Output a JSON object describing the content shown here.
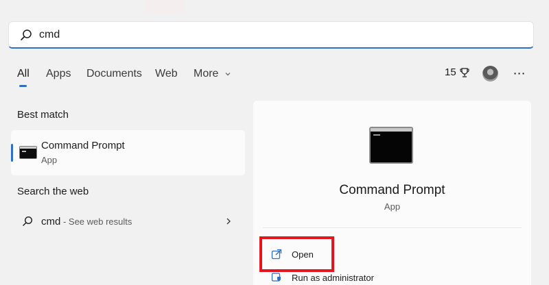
{
  "search": {
    "value": "cmd"
  },
  "tabs": [
    {
      "label": "All",
      "active": true
    },
    {
      "label": "Apps"
    },
    {
      "label": "Documents"
    },
    {
      "label": "Web"
    },
    {
      "label": "More"
    }
  ],
  "header": {
    "points": "15",
    "icons": [
      "trophy-icon",
      "avatar",
      "more-dots-icon"
    ]
  },
  "best_match": {
    "section_title": "Best match",
    "title": "Command Prompt",
    "subtitle": "App"
  },
  "web": {
    "section_title": "Search the web",
    "term": "cmd",
    "suffix": " - See web results"
  },
  "detail": {
    "title": "Command Prompt",
    "subtitle": "App",
    "actions": [
      {
        "label": "Open",
        "icon": "open-external-icon"
      },
      {
        "label": "Run as administrator",
        "icon": "shield-icon"
      }
    ]
  },
  "colors": {
    "accent": "#2f6ec4",
    "highlight": "#e4151f",
    "background": "#f1f1f2",
    "card": "#fbfbfb"
  }
}
